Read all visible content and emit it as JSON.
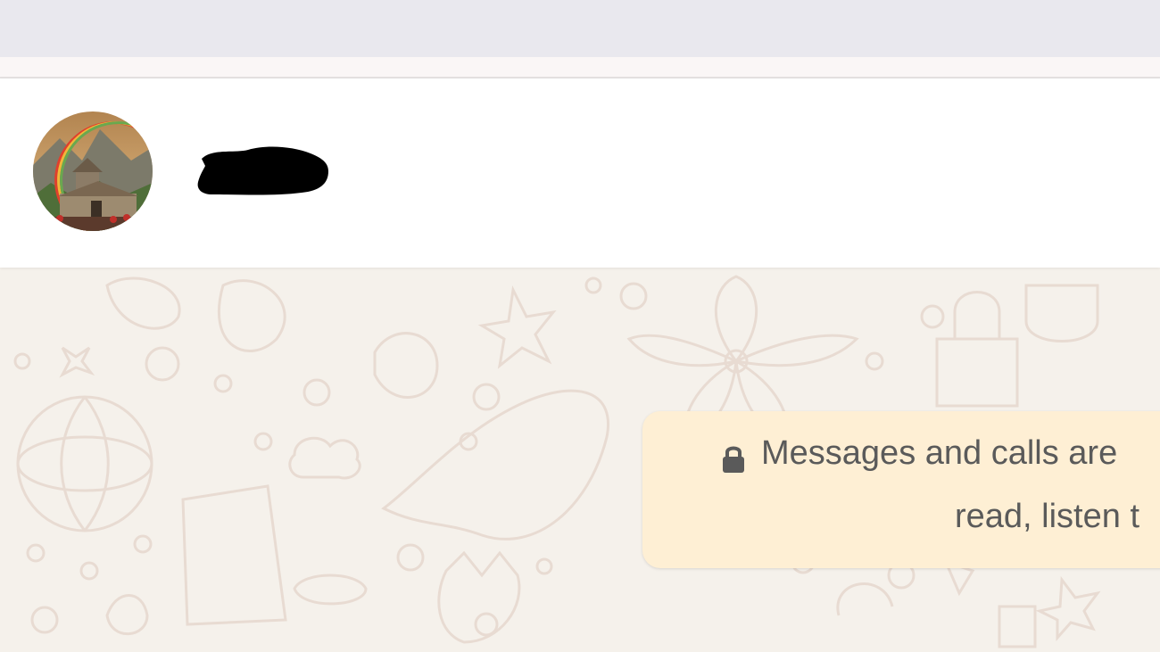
{
  "chat": {
    "encryption_notice": {
      "line1": "Messages and calls are",
      "line2": "read, listen t",
      "icon": "lock-icon"
    }
  },
  "colors": {
    "header_bg": "#ffffff",
    "chat_bg": "#f5f1eb",
    "notice_bg": "#feefd4",
    "notice_text": "#5a5a5a"
  }
}
